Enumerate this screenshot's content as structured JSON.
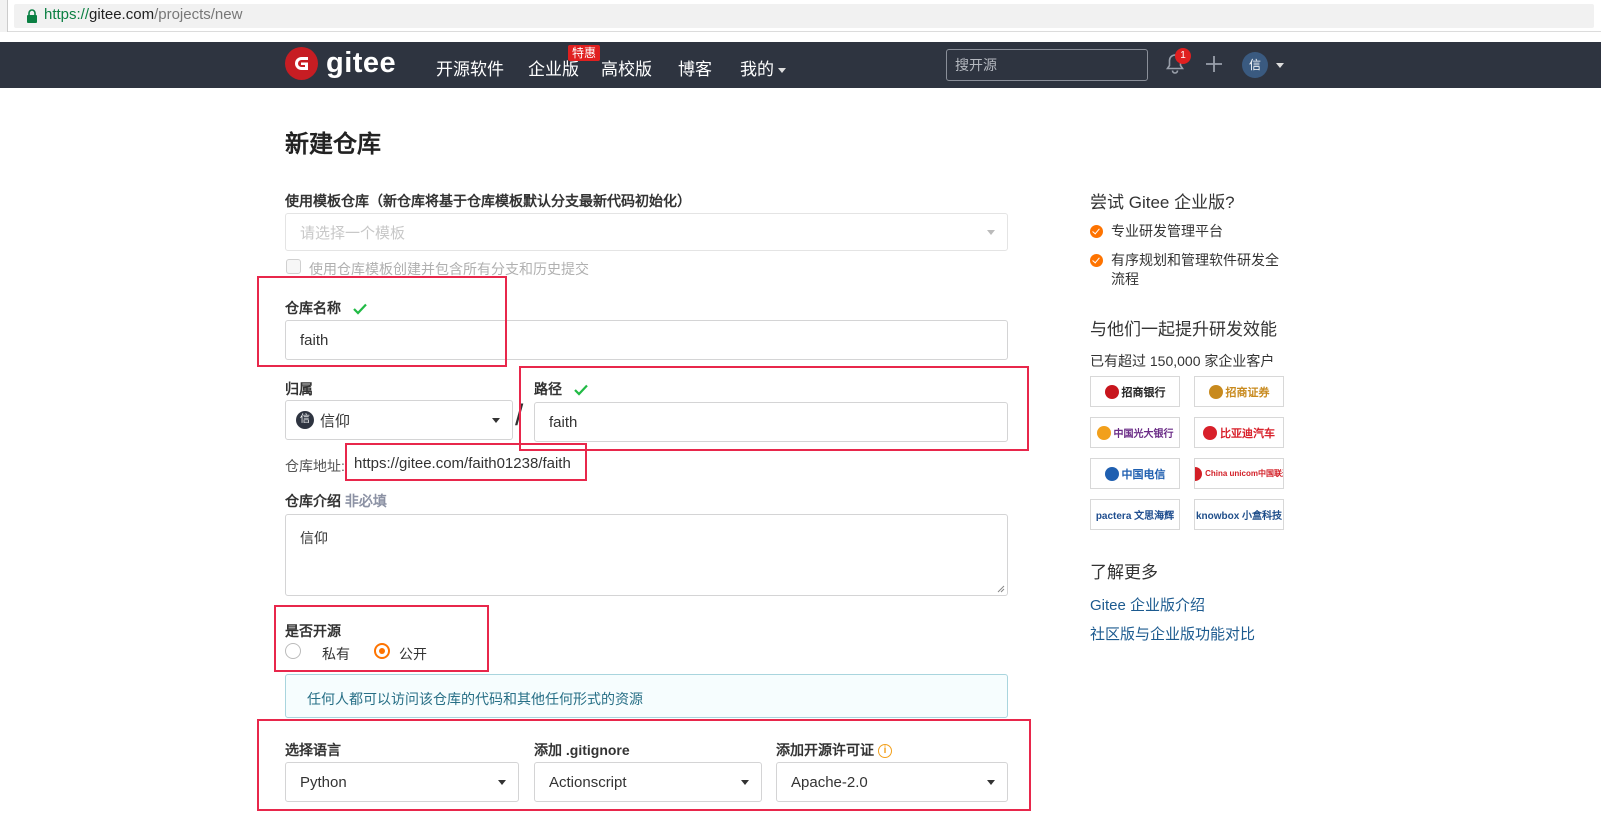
{
  "browser": {
    "url_scheme": "https://",
    "url_host": "gitee.com",
    "url_path": "/projects/new"
  },
  "nav": {
    "logo_text": "gitee",
    "links": [
      "开源软件",
      "企业版",
      "高校版",
      "博客",
      "我的"
    ],
    "enterprise_badge": "特惠",
    "search_placeholder": "搜开源",
    "notification_count": "1",
    "avatar_text": "信"
  },
  "form": {
    "page_title": "新建仓库",
    "template_label": "使用模板仓库（新仓库将基于仓库模板默认分支最新代码初始化）",
    "template_placeholder": "请选择一个模板",
    "template_checkbox_label": "使用仓库模板创建并包含所有分支和历史提交",
    "repo_name_label": "仓库名称",
    "repo_name_value": "faith",
    "owner_label": "归属",
    "owner_avatar": "信",
    "owner_value": "信仰",
    "path_label": "路径",
    "path_value": "faith",
    "address_label": "仓库地址:",
    "address_value": "https://gitee.com/faith01238/faith",
    "desc_label": "仓库介绍",
    "desc_optional": "非必填",
    "desc_value": "信仰",
    "visibility_label": "是否开源",
    "visibility_options": [
      "私有",
      "公开"
    ],
    "visibility_selected": "公开",
    "visibility_notice": "任何人都可以访问该仓库的代码和其他任何形式的资源",
    "language_label": "选择语言",
    "language_value": "Python",
    "gitignore_label": "添加 .gitignore",
    "gitignore_value": "Actionscript",
    "license_label": "添加开源许可证",
    "license_value": "Apache-2.0"
  },
  "sidebar": {
    "try_title": "尝试 Gitee 企业版?",
    "features": [
      "专业研发管理平台",
      "有序规划和管理软件研发全流程"
    ],
    "together_title": "与他们一起提升研发效能",
    "customers_text": "已有超过 150,000 家企业客户",
    "customer_logos": [
      {
        "name": "招商银行",
        "color": "#c8151d"
      },
      {
        "name": "招商证券",
        "color": "#c88a1e"
      },
      {
        "name": "中国光大银行",
        "color": "#6a2b86"
      },
      {
        "name": "比亚迪汽车",
        "color": "#d8202a"
      },
      {
        "name": "中国电信",
        "color": "#1f5fb0"
      },
      {
        "name": "China unicom中国联通",
        "color": "#d21e26"
      },
      {
        "name": "pactera 文思海辉",
        "color": "#1e4d8f"
      },
      {
        "name": "knowbox 小盒科技",
        "color": "#1f4e8a"
      }
    ],
    "learn_title": "了解更多",
    "links": [
      "Gitee 企业版介绍",
      "社区版与企业版功能对比"
    ]
  },
  "colors": {
    "nav_bg": "#2e3440",
    "accent": "#fe7300",
    "link": "#1c5a8f",
    "annotation": "#e8274b",
    "success": "#21ba45"
  }
}
